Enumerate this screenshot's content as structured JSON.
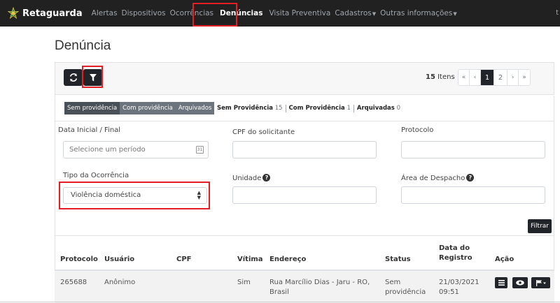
{
  "navbar": {
    "brand": "Retaguarda",
    "links": [
      {
        "label": "Alertas"
      },
      {
        "label": "Dispositivos"
      },
      {
        "label": "Ocorrências"
      },
      {
        "label": "Denúncias",
        "active": true
      },
      {
        "label": "Visita Preventiva"
      },
      {
        "label": "Cadastros",
        "dropdown": true
      },
      {
        "label": "Outras informações",
        "dropdown": true
      }
    ],
    "right_fragment": "t"
  },
  "page": {
    "title": "Denúncia"
  },
  "toolbar": {
    "refresh_icon": "refresh-icon",
    "filter_icon": "filter-icon",
    "items_count": "15",
    "items_label": "Itens",
    "pagination": {
      "first": "«",
      "prev": "‹",
      "pages": [
        "1",
        "2"
      ],
      "current": "1",
      "next": "›",
      "last": "»"
    }
  },
  "tabs": {
    "buttons": [
      "Sem providência",
      "Com providência",
      "Arquivados"
    ],
    "active": "Sem providência",
    "counts": [
      {
        "label": "Sem Providência",
        "value": "15"
      },
      {
        "label": "Com Providência",
        "value": "1"
      },
      {
        "label": "Arquivadas",
        "value": "0"
      }
    ]
  },
  "filters": {
    "date_label": "Data Inicial / Final",
    "date_placeholder": "Selecione um período",
    "cpf_label": "CPF do solicitante",
    "protocolo_label": "Protocolo",
    "tipo_label": "Tipo da Ocorrência",
    "tipo_value": "Violência doméstica",
    "unidade_label": "Unidade",
    "area_label": "Área de Despacho",
    "filter_button": "Filtrar"
  },
  "table": {
    "headers": {
      "protocolo": "Protocolo",
      "usuario": "Usuário",
      "cpf": "CPF",
      "vitima": "Vítima",
      "endereco": "Endereço",
      "status": "Status",
      "data_l1": "Data do",
      "data_l2": "Registro",
      "acao": "Ação"
    },
    "rows": [
      {
        "protocolo": "265688",
        "usuario": "Anônimo",
        "cpf": "",
        "vitima": "Sim",
        "endereco_l1": "Rua Marcílio Dias - Jaru - RO,",
        "endereco_l2": "Brasil",
        "status_l1": "Sem",
        "status_l2": "providência",
        "data_l1": "21/03/2021",
        "data_l2": "09:51"
      }
    ]
  },
  "colors": {
    "navbar": "#212121",
    "dark_button": "#212529",
    "highlight": "#e31e24",
    "tab_active": "#495057",
    "tab": "#6c757d"
  }
}
